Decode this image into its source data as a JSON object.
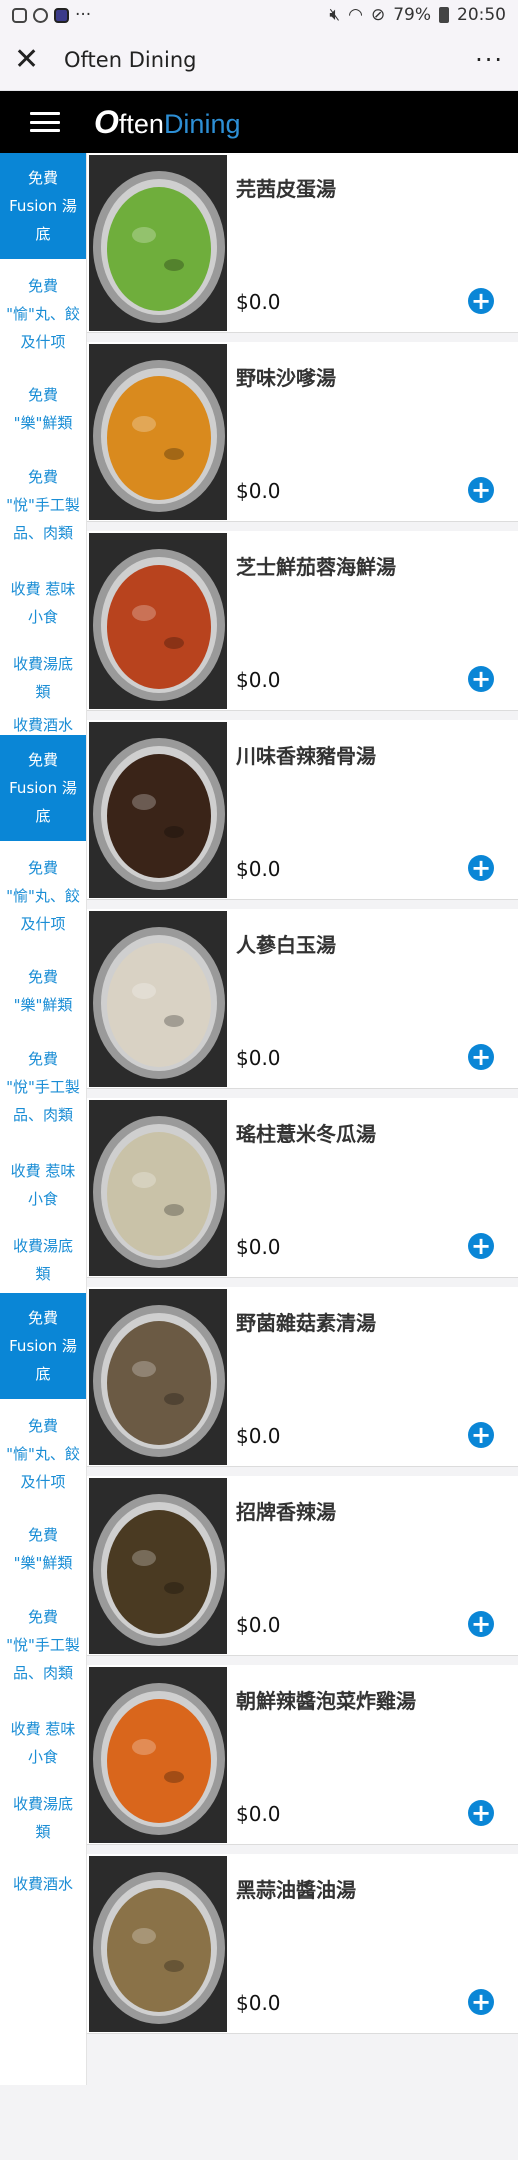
{
  "status_bar": {
    "battery": "79%",
    "time": "20:50"
  },
  "app_bar": {
    "title": "Often Dining"
  },
  "brand": {
    "o": "O",
    "often": "ften",
    "dining": "Dining"
  },
  "sidebar": [
    {
      "label": "免費 Fusion 湯底",
      "active": true
    },
    {
      "label": "免費 \"愉\"丸、餃及什项",
      "active": false
    },
    {
      "label": "免費 \"樂\"鮮類",
      "active": false
    },
    {
      "label": "免費 \"悅\"手工製品、肉類",
      "active": false
    },
    {
      "label": "收費 惹味小食",
      "active": false
    },
    {
      "label": "收費湯底類",
      "active": false
    },
    {
      "label": "收費酒水",
      "active": false
    },
    {
      "label": "免費 Fusion 湯底",
      "active": true
    },
    {
      "label": "免費 \"愉\"丸、餃及什项",
      "active": false
    },
    {
      "label": "免費 \"樂\"鮮類",
      "active": false
    },
    {
      "label": "免費 \"悅\"手工製品、肉類",
      "active": false
    },
    {
      "label": "收費 惹味小食",
      "active": false
    },
    {
      "label": "收費湯底類",
      "active": false
    },
    {
      "label": "免費 Fusion 湯底",
      "active": true
    },
    {
      "label": "免費 \"愉\"丸、餃及什项",
      "active": false
    },
    {
      "label": "免費 \"樂\"鮮類",
      "active": false
    },
    {
      "label": "免費 \"悅\"手工製品、肉類",
      "active": false
    },
    {
      "label": "收費 惹味小食",
      "active": false
    },
    {
      "label": "收費湯底類",
      "active": false
    },
    {
      "label": "收費酒水",
      "active": false
    }
  ],
  "items": [
    {
      "name": "芫茜皮蛋湯",
      "price": "$0.0",
      "soup": "#6fae3c",
      "add": "+"
    },
    {
      "name": "野味沙嗲湯",
      "price": "$0.0",
      "soup": "#d98a1e",
      "add": "+"
    },
    {
      "name": "芝士鮮茄蓉海鮮湯",
      "price": "$0.0",
      "soup": "#b8431e",
      "add": "+"
    },
    {
      "name": "川味香辣豬骨湯",
      "price": "$0.0",
      "soup": "#3a2418",
      "add": "+"
    },
    {
      "name": "人蔘白玉湯",
      "price": "$0.0",
      "soup": "#d9d2c4",
      "add": "+"
    },
    {
      "name": "瑤柱薏米冬瓜湯",
      "price": "$0.0",
      "soup": "#c9c2a8",
      "add": "+"
    },
    {
      "name": "野菌雜菇素清湯",
      "price": "$0.0",
      "soup": "#6b5a44",
      "add": "+"
    },
    {
      "name": "招牌香辣湯",
      "price": "$0.0",
      "soup": "#4a3a22",
      "add": "+"
    },
    {
      "name": "朝鮮辣醬泡菜炸雞湯",
      "price": "$0.0",
      "soup": "#d9661c",
      "add": "+"
    },
    {
      "name": "黑蒜油醬油湯",
      "price": "$0.0",
      "soup": "#8a7248",
      "add": "+"
    }
  ],
  "colors": {
    "accent": "#0a86d6",
    "brand_bg": "#000000"
  }
}
